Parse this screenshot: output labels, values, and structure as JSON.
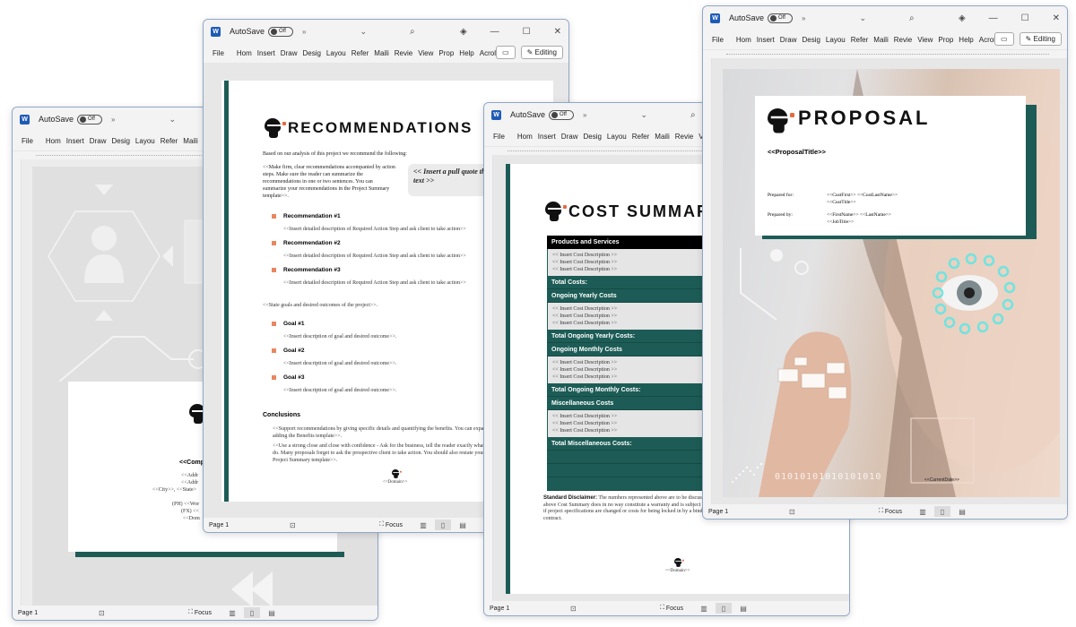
{
  "app": {
    "autosave_label": "AutoSave",
    "autosave_state": "Off",
    "ribbon_tabs": [
      "File",
      "Home",
      "Insert",
      "Draw",
      "Design",
      "Layout",
      "References",
      "Mailings",
      "Review",
      "View",
      "Properties",
      "Help",
      "Acrobat"
    ],
    "ribbon_tabs_truncated": [
      "File",
      "Hom",
      "Insert",
      "Draw",
      "Desig",
      "Layou",
      "Refer",
      "Maili",
      "Revie",
      "View",
      "Prop",
      "Help",
      "Acrol"
    ],
    "editing_label": "Editing",
    "status_page": "Page 1",
    "status_focus": "Focus",
    "icons": {
      "word": "word-logo-icon",
      "more": "chevrons-right-icon",
      "dropdown": "chevron-down-icon",
      "search": "search-icon",
      "diamond": "designer-icon",
      "minimize": "minimize-icon",
      "maximize": "maximize-icon",
      "close": "close-icon",
      "comment": "comment-icon",
      "pencil": "pencil-icon",
      "read": "accessibility-icon",
      "focus": "focus-icon",
      "read_mode": "read-mode-icon",
      "print_layout": "print-layout-icon",
      "web_layout": "web-layout-icon"
    }
  },
  "windows": {
    "cover": {
      "company_placeholder": "<<Comp",
      "address_lines": [
        "<<Addr",
        "<<Addr",
        "<<City>>, <<State>"
      ],
      "phone_lines": [
        "(PH) <<Wor",
        "(FX) <<",
        "<<Dom"
      ]
    },
    "recommendations": {
      "title": "RECOMMENDATIONS",
      "intro": "Based on our analysis of this project we recommend the following:",
      "summary": "<<Make firm, clear recommendations accompanied by action steps.  Make sure the reader can summarize the recommendations in one or two sentences.  You can summarize your recommendations in the Project Summary template>>.",
      "pull_quote": "<< Insert a pull quote that will be in emphas text >>",
      "recommendations": [
        {
          "label": "Recommendation #1",
          "text": "<<Insert detailed description of Required Action Step and ask client to take action>>"
        },
        {
          "label": "Recommendation #2",
          "text": "<<Insert detailed description of Required Action Step and ask client to take action>>"
        },
        {
          "label": "Recommendation #3",
          "text": "<<Insert detailed description of Required Action Step and ask client to take action>>"
        }
      ],
      "goals_intro": "<<State goals and desired outcomes of the project>>.",
      "goals": [
        {
          "label": "Goal #1",
          "text": "<<Insert description of goal and desired outcome>>."
        },
        {
          "label": "Goal #2",
          "text": "<<Insert description of goal and desired outcome>>."
        },
        {
          "label": "Goal #3",
          "text": "<<Insert description of goal and desired outcome>>."
        }
      ],
      "conclusions_heading": "Conclusions",
      "conclusion_1": "<<Support recommendations by giving specific details and quantifying the benefits.  You can expand on the benefits by adding the Benefits template>>.",
      "conclusion_2": "<<Use a strong close and close with confidence - Ask for the business, tell the reader exactly what you want him or her to do.  Many proposals forget to ask the prospective client to take action. You should also restate your request for action in the Project Summary template>>.",
      "domain": "<<Domain>>"
    },
    "cost_summary": {
      "title": "COST SUMMARY",
      "sections": [
        {
          "header": "Products and Services",
          "header_style": "black",
          "rows": [
            "<< Insert Cost Description >>",
            "<< Insert Cost Description >>",
            "<< Insert Cost Description >>"
          ],
          "total": "Total Costs:"
        },
        {
          "header": "Ongoing Yearly Costs",
          "header_style": "teal",
          "rows": [
            "<< Insert Cost Description >>",
            "<< Insert Cost Description >>",
            "<< Insert Cost Description >>"
          ],
          "total": "Total Ongoing Yearly Costs:"
        },
        {
          "header": "Ongoing Monthly Costs",
          "header_style": "teal",
          "rows": [
            "<< Insert Cost Description >>",
            "<< Insert Cost Description >>",
            "<< Insert Cost Description >>"
          ],
          "total": "Total Ongoing Monthly Costs:"
        },
        {
          "header": "Miscellaneous Costs",
          "header_style": "teal",
          "rows": [
            "<< Insert Cost Description >>",
            "<< Insert Cost Description >>",
            "<< Insert Cost Description >>"
          ],
          "total": "Total Miscellaneous Costs:"
        }
      ],
      "disclaimer_label": "Standard Disclaimer:",
      "disclaimer_text": " The numbers represented above are to be discussed. The above Cost Summary does in no way constitute a warranty and is subject to change if project specifications are changed or costs for being locked in by a binding contract.",
      "domain": "<<Domain>>"
    },
    "proposal": {
      "title": "PROPOSAL",
      "proposal_title": "<<ProposalTitle>>",
      "prepared_for_label": "Prepared for:",
      "prepared_for_value_1": "<<CustFirst>> <<CustLastName>>",
      "prepared_for_value_2": "<<CustTitle>>",
      "prepared_by_label": "Prepared by:",
      "prepared_by_value_1": "<<FirstName>> <<LastName>>",
      "prepared_by_value_2": "<<JobTitle>>",
      "binary_text": "01010101010101010",
      "current_date": "<<CurrentDate>>"
    }
  },
  "colors": {
    "teal": "#1d5c56",
    "bullet_orange": "#e8875f",
    "word_blue": "#1e5bb8"
  }
}
